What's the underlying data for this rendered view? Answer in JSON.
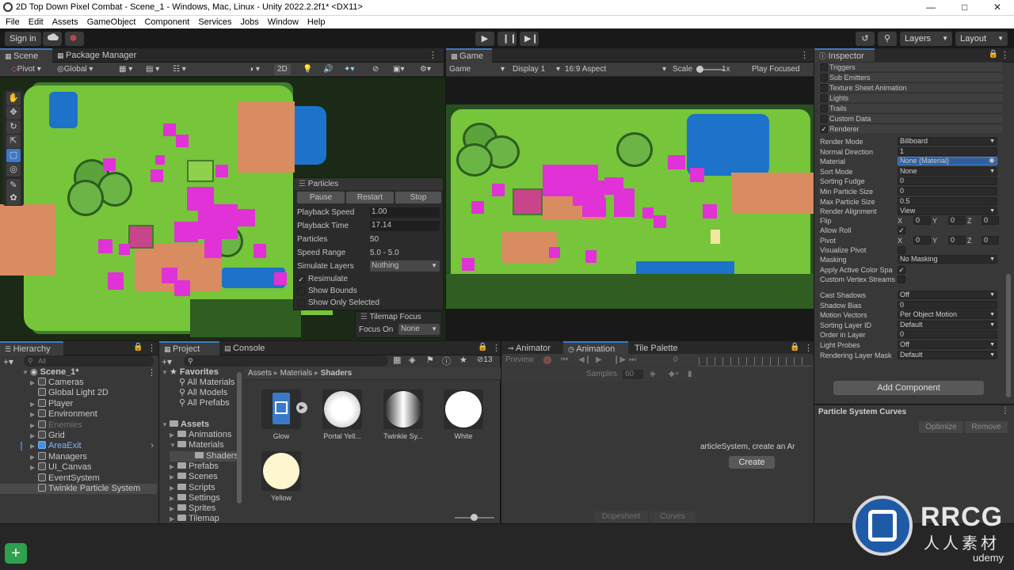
{
  "window": {
    "title": "2D Top Down Pixel Combat - Scene_1 - Windows, Mac, Linux - Unity 2022.2.2f1* <DX11>"
  },
  "menu": [
    "File",
    "Edit",
    "Assets",
    "GameObject",
    "Component",
    "Services",
    "Jobs",
    "Window",
    "Help"
  ],
  "toolbar": {
    "sign_in": "Sign in",
    "layers": "Layers",
    "layout": "Layout"
  },
  "scene": {
    "tab_scene": "Scene",
    "tab_package_manager": "Package Manager",
    "pivot": "Pivot",
    "global": "Global",
    "mode_2d": "2D"
  },
  "particles_overlay": {
    "title": "Particles",
    "pause": "Pause",
    "restart": "Restart",
    "stop": "Stop",
    "rows": [
      {
        "label": "Playback Speed",
        "value": "1.00"
      },
      {
        "label": "Playback Time",
        "value": "17.14"
      },
      {
        "label": "Particles",
        "value": "50"
      },
      {
        "label": "Speed Range",
        "value": "5.0 - 5.0"
      },
      {
        "label": "Simulate Layers",
        "value": "Nothing"
      }
    ],
    "resimulate": "Resimulate",
    "show_bounds": "Show Bounds",
    "show_only_selected": "Show Only Selected",
    "tilemap_focus": "Tilemap Focus",
    "focus_on": "Focus On",
    "focus_value": "None"
  },
  "game": {
    "tab": "Game",
    "game_dropdown": "Game",
    "display": "Display 1",
    "aspect": "16:9 Aspect",
    "scale_label": "Scale",
    "scale_value": "1x",
    "play_focused": "Play Focused"
  },
  "inspector": {
    "tab": "Inspector",
    "modules": [
      {
        "label": "Triggers",
        "checked": false
      },
      {
        "label": "Sub Emitters",
        "checked": false
      },
      {
        "label": "Texture Sheet Animation",
        "checked": false
      },
      {
        "label": "Lights",
        "checked": false
      },
      {
        "label": "Trails",
        "checked": false
      },
      {
        "label": "Custom Data",
        "checked": false
      },
      {
        "label": "Renderer",
        "checked": true
      }
    ],
    "props": [
      {
        "label": "Render Mode",
        "value": "Billboard",
        "dropdown": true
      },
      {
        "label": "Normal Direction",
        "value": "1"
      },
      {
        "label": "Material",
        "value": "None (Material)",
        "highlight": true
      },
      {
        "label": "Sort Mode",
        "value": "None",
        "dropdown": true
      },
      {
        "label": "Sorting Fudge",
        "value": "0"
      },
      {
        "label": "Min Particle Size",
        "value": "0"
      },
      {
        "label": "Max Particle Size",
        "value": "0.5"
      },
      {
        "label": "Render Alignment",
        "value": "View",
        "dropdown": true
      }
    ],
    "flip_label": "Flip",
    "flip": {
      "x": "0",
      "y": "0",
      "z": "0"
    },
    "allow_roll": "Allow Roll",
    "pivot_label": "Pivot",
    "pivot": {
      "x": "0",
      "y": "0",
      "z": "0"
    },
    "visualize_pivot": "Visualize Pivot",
    "masking_label": "Masking",
    "masking_value": "No Masking",
    "apply_active_color": "Apply Active Color Spa",
    "custom_vertex": "Custom Vertex Streams",
    "props2": [
      {
        "label": "Cast Shadows",
        "value": "Off",
        "dropdown": true
      },
      {
        "label": "Shadow Bias",
        "value": "0"
      },
      {
        "label": "Motion Vectors",
        "value": "Per Object Motion",
        "dropdown": true
      },
      {
        "label": "Sorting Layer ID",
        "value": "Default",
        "dropdown": true
      },
      {
        "label": "Order in Layer",
        "value": "0"
      },
      {
        "label": "Light Probes",
        "value": "Off",
        "dropdown": true
      },
      {
        "label": "Rendering Layer Mask",
        "value": "Default",
        "dropdown": true
      }
    ],
    "add_component": "Add Component",
    "curves_title": "Particle System Curves",
    "optimize": "Optimize",
    "remove": "Remove"
  },
  "hierarchy": {
    "tab": "Hierarchy",
    "search_placeholder": "All",
    "scene_name": "Scene_1*",
    "items": [
      {
        "label": "Cameras",
        "expandable": true
      },
      {
        "label": "Global Light 2D",
        "expandable": false
      },
      {
        "label": "Player",
        "expandable": true
      },
      {
        "label": "Environment",
        "expandable": true
      },
      {
        "label": "Enemies",
        "expandable": true,
        "disabled": true
      },
      {
        "label": "Grid",
        "expandable": true
      },
      {
        "label": "AreaExit",
        "expandable": true,
        "prefab": true
      },
      {
        "label": "Managers",
        "expandable": true
      },
      {
        "label": "UI_Canvas",
        "expandable": true
      },
      {
        "label": "EventSystem",
        "expandable": false
      },
      {
        "label": "Twinkle Particle System",
        "expandable": false,
        "selected": true
      }
    ]
  },
  "project": {
    "tab_project": "Project",
    "tab_console": "Console",
    "hidden_count": "13",
    "favorites": "Favorites",
    "fav_items": [
      "All Materials",
      "All Models",
      "All Prefabs"
    ],
    "assets": "Assets",
    "folders": [
      {
        "label": "Animations",
        "indent": 1
      },
      {
        "label": "Materials",
        "indent": 1,
        "open": true
      },
      {
        "label": "Shaders",
        "indent": 2,
        "selected": true
      },
      {
        "label": "Prefabs",
        "indent": 1
      },
      {
        "label": "Scenes",
        "indent": 1
      },
      {
        "label": "Scripts",
        "indent": 1
      },
      {
        "label": "Settings",
        "indent": 1
      },
      {
        "label": "Sprites",
        "indent": 1
      },
      {
        "label": "Tilemap",
        "indent": 1
      }
    ],
    "breadcrumb": [
      "Assets",
      "Materials",
      "Shaders"
    ],
    "assets_grid": [
      {
        "label": "Glow"
      },
      {
        "label": "Portal Yell..."
      },
      {
        "label": "Twinkle Sy..."
      },
      {
        "label": "White"
      },
      {
        "label": "Yellow"
      }
    ]
  },
  "animation": {
    "tab_animator": "Animator",
    "tab_animation": "Animation",
    "tab_tile_palette": "Tile Palette",
    "preview": "Preview",
    "frame": "0",
    "samples_label": "Samples",
    "samples_value": "60",
    "message": "articleSystem, create an Ar",
    "create": "Create",
    "dopesheet": "Dopesheet",
    "curves": "Curves"
  },
  "watermark": {
    "brand": "RRCG",
    "sub": "人人素材",
    "udemy": "udemy"
  },
  "colors": {
    "accent": "#3a79c8",
    "magenta": "#e032d6",
    "grass": "#7cc63a",
    "water": "#1d73c9",
    "dirt": "#d98c5f"
  }
}
